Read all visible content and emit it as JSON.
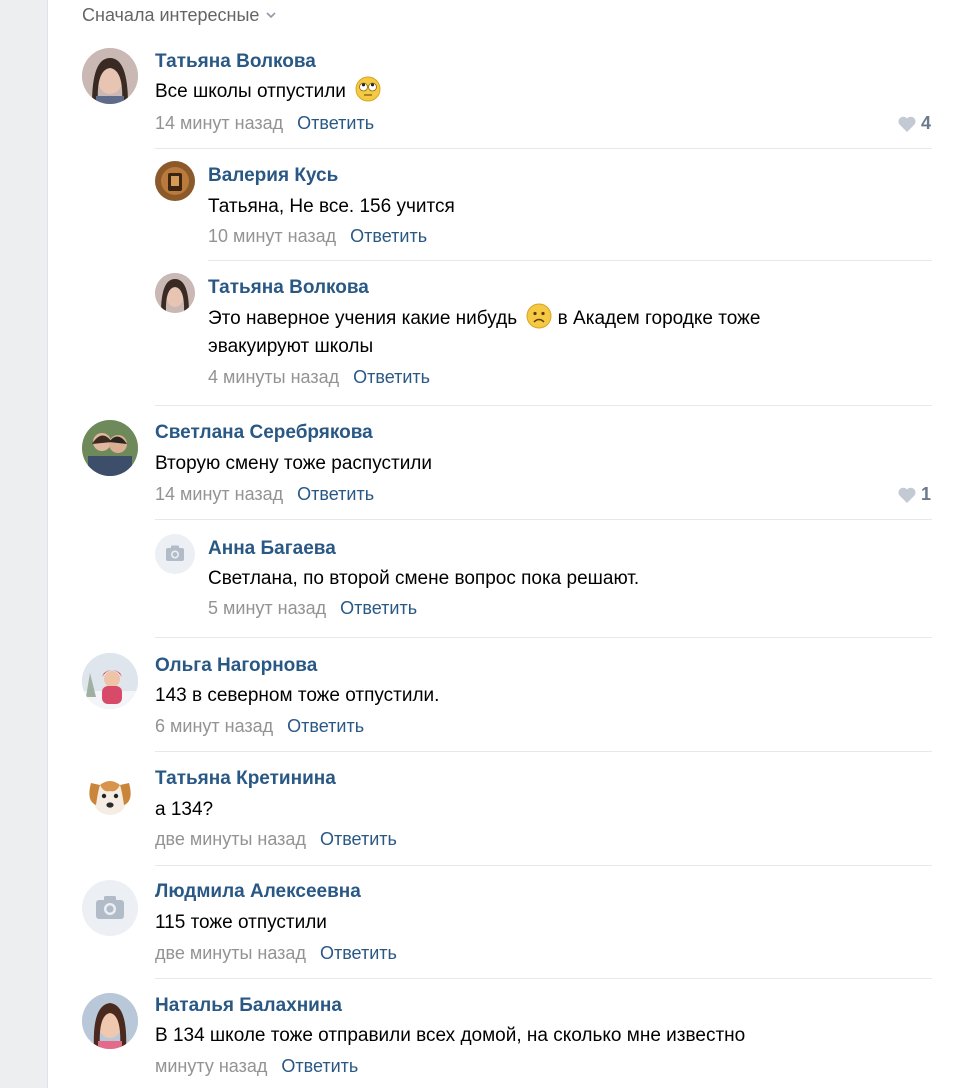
{
  "sort": {
    "label": "Сначала интересные"
  },
  "comments": [
    {
      "name": "Татьяна Волкова",
      "text": "Все школы отпустили",
      "emoji": "rolling-eyes-emoji",
      "time": "14 минут назад",
      "reply": "Ответить",
      "likes": "4"
    },
    {
      "name": "Валерия Кусь",
      "text": "Татьяна, Не все. 156 учится",
      "time": "10 минут назад",
      "reply": "Ответить"
    },
    {
      "name": "Татьяна Волкова",
      "text_before": "Это наверное учения какие нибудь",
      "emoji": "sad-face-emoji",
      "text_after": "в Академ городке тоже",
      "text_line2": "эвакуируют школы",
      "time": "4 минуты назад",
      "reply": "Ответить"
    },
    {
      "name": "Светлана Серебрякова",
      "text": "Вторую смену тоже распустили",
      "time": "14 минут назад",
      "reply": "Ответить",
      "likes": "1"
    },
    {
      "name": "Анна Багаева",
      "text": "Светлана, по второй смене вопрос пока решают.",
      "time": "5 минут назад",
      "reply": "Ответить",
      "avatar": "camera-icon"
    },
    {
      "name": "Ольга Нагорнова",
      "text": "143 в северном тоже отпустили.",
      "time": "6 минут назад",
      "reply": "Ответить"
    },
    {
      "name": "Татьяна Кретинина",
      "text": "а 134?",
      "time": "две минуты назад",
      "reply": "Ответить"
    },
    {
      "name": "Людмила Алексеевна",
      "text": "115 тоже отпустили",
      "time": "две минуты назад",
      "reply": "Ответить",
      "avatar": "camera-icon"
    },
    {
      "name": "Наталья Балахнина",
      "text": "В 134 школе тоже отправили всех домой, на сколько мне известно",
      "time": "минуту назад",
      "reply": "Ответить"
    }
  ],
  "colors": {
    "link": "#2a5885",
    "meta": "#939393",
    "separator": "#e7e8ec",
    "gutter": "#edeef0"
  }
}
